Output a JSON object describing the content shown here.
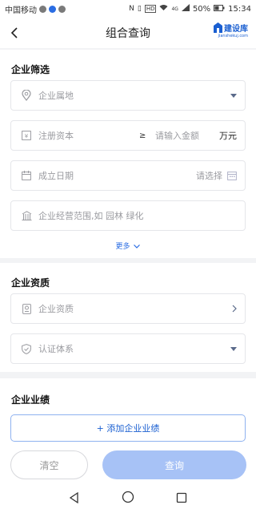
{
  "status_bar": {
    "carrier": "中国移动",
    "hd": "HD",
    "signal": "4G",
    "battery": "50%",
    "time": "15:34"
  },
  "nav": {
    "title": "组合查询",
    "logo_text": "建设库",
    "logo_sub": "jianshekuj.com"
  },
  "company_filter": {
    "title": "企业筛选",
    "location_placeholder": "企业属地",
    "capital_placeholder": "注册资本",
    "compare_symbol": "≥",
    "amount_placeholder": "请输入金额",
    "amount_unit": "万元",
    "date_label": "成立日期",
    "date_placeholder": "请选择",
    "scope_placeholder": "企业经营范围,如 园林 绿化",
    "more_label": "更多"
  },
  "qualification": {
    "title": "企业资质",
    "qualification_label": "企业资质",
    "certification_label": "认证体系"
  },
  "performance": {
    "title": "企业业绩",
    "add_label": "+ 添加企业业绩"
  },
  "actions": {
    "clear_label": "清空",
    "query_label": "查询"
  },
  "colors": {
    "accent": "#1a5fd1",
    "query_button": "#a7c2f6",
    "border": "#e5e6ea"
  }
}
